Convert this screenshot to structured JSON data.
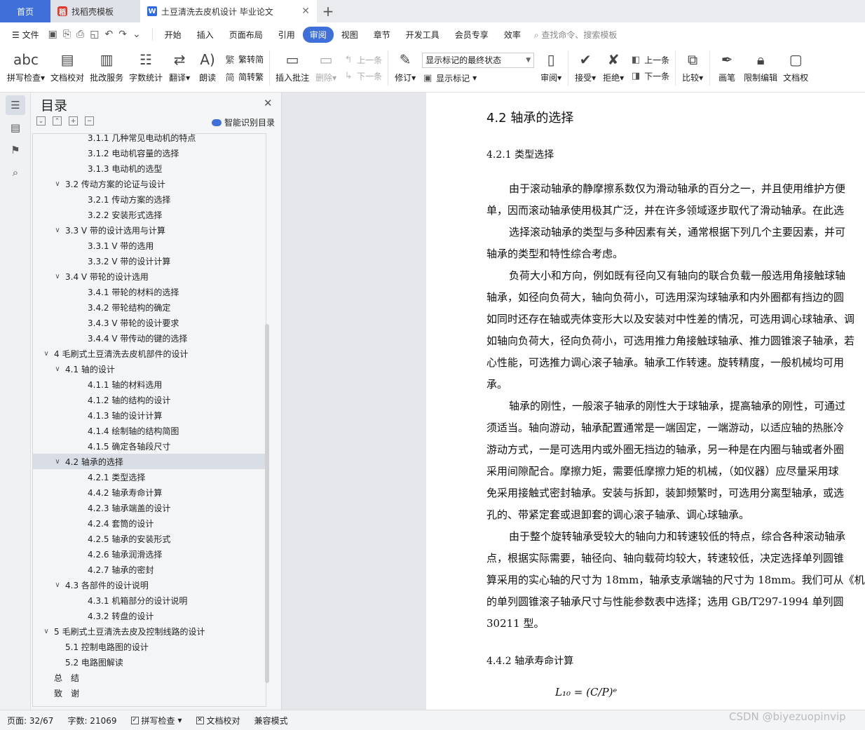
{
  "tabs": [
    {
      "label": "首页"
    },
    {
      "label": "找稻壳模板"
    },
    {
      "label": "土豆清洗去皮机设计 毕业论文"
    }
  ],
  "menu": {
    "file": "文件",
    "items": [
      "开始",
      "插入",
      "页面布局",
      "引用",
      "审阅",
      "视图",
      "章节",
      "开发工具",
      "会员专享",
      "效率"
    ],
    "active": "审阅",
    "search_placeholder": "查找命令、搜索模板"
  },
  "ribbon": {
    "spell_check": "拼写检查",
    "doc_proof": "文档校对",
    "annotate_service": "批改服务",
    "word_count": "字数统计",
    "translate": "翻译",
    "read_aloud": "朗读",
    "to_traditional": "繁转简",
    "to_simplified": "简转繁",
    "insert_comment": "插入批注",
    "delete": "删除",
    "prev_comment": "上一条",
    "next_comment": "下一条",
    "track": "修订",
    "markup_view": "显示标记的最终状态",
    "show_markup": "显示标记",
    "review": "审阅",
    "accept": "接受",
    "reject": "拒绝",
    "prev_change": "上一条",
    "next_change": "下一条",
    "compare": "比较",
    "ink": "画笔",
    "restrict": "限制编辑",
    "doc_perm": "文档权"
  },
  "toc": {
    "title": "目录",
    "smart_label": "智能识别目录",
    "items": [
      {
        "text": "3.1.1 几种常见电动机的特点",
        "level": 3
      },
      {
        "text": "3.1.2 电动机容量的选择",
        "level": 3
      },
      {
        "text": "3.1.3 电动机的选型",
        "level": 3
      },
      {
        "text": "3.2 传动方案的论证与设计",
        "level": 2
      },
      {
        "text": "3.2.1 传动方案的选择",
        "level": 3
      },
      {
        "text": "3.2.2 安装形式选择",
        "level": 3
      },
      {
        "text": "3.3 V 带的设计选用与计算",
        "level": 2
      },
      {
        "text": "3.3.1 V 带的选用",
        "level": 3
      },
      {
        "text": "3.3.2 V 带的设计计算",
        "level": 3
      },
      {
        "text": "3.4 V 带轮的设计选用",
        "level": 2
      },
      {
        "text": "3.4.1 带轮的材料的选择",
        "level": 3
      },
      {
        "text": "3.4.2 带轮结构的确定",
        "level": 3
      },
      {
        "text": "3.4.3 V 带轮的设计要求",
        "level": 3
      },
      {
        "text": "3.4.4 V 带传动的键的选择",
        "level": 3
      },
      {
        "text": "4 毛刷式土豆清洗去皮机部件的设计",
        "level": 1
      },
      {
        "text": "4.1 轴的设计",
        "level": 2
      },
      {
        "text": "4.1.1 轴的材料选用",
        "level": 3
      },
      {
        "text": "4.1.2 轴的结构的设计",
        "level": 3
      },
      {
        "text": "4.1.3 轴的设计计算",
        "level": 3
      },
      {
        "text": "4.1.4 绘制轴的结构简图",
        "level": 3
      },
      {
        "text": "4.1.5 确定各轴段尺寸",
        "level": 3
      },
      {
        "text": "4.2 轴承的选择",
        "level": 2
      },
      {
        "text": "4.2.1 类型选择",
        "level": 3
      },
      {
        "text": "4.4.2 轴承寿命计算",
        "level": 3
      },
      {
        "text": "4.2.3 轴承端盖的设计",
        "level": 3
      },
      {
        "text": "4.2.4 套筒的设计",
        "level": 3
      },
      {
        "text": "4.2.5 轴承的安装形式",
        "level": 3
      },
      {
        "text": "4.2.6 轴承润滑选择",
        "level": 3
      },
      {
        "text": "4.2.7 轴承的密封",
        "level": 3
      },
      {
        "text": "4.3 各部件的设计说明",
        "level": 2
      },
      {
        "text": "4.3.1 机箱部分的设计说明",
        "level": 3
      },
      {
        "text": "4.3.2 转盘的设计",
        "level": 3
      },
      {
        "text": "5 毛刷式土豆清洗去皮及控制线路的设计",
        "level": 1
      },
      {
        "text": "5.1 控制电路图的设计",
        "level": 2
      },
      {
        "text": "5.2 电路图解读",
        "level": 2
      },
      {
        "text": "总　结",
        "level": 1
      },
      {
        "text": "致　谢",
        "level": 1
      }
    ],
    "selected_index": 21
  },
  "document": {
    "heading": "4.2 轴承的选择",
    "sub1": "4.2.1 类型选择",
    "lines": [
      {
        "text": "由于滚动轴承的静摩擦系数仅为滑动轴承的百分之一，并且使用维护方便",
        "indent": true
      },
      {
        "text": "单，因而滚动轴承使用极其广泛，并在许多领域逐步取代了滑动轴承。在此选",
        "indent": false
      },
      {
        "text": "选择滚动轴承的类型与多种因素有关，通常根据下列几个主要因素，并可",
        "indent": true
      },
      {
        "text": "轴承的类型和特性综合考虑。",
        "indent": false
      },
      {
        "text": "负荷大小和方向，例如既有径向又有轴向的联合负载一般选用角接触球轴",
        "indent": true
      },
      {
        "text": "轴承，如径向负荷大，轴向负荷小，可选用深沟球轴承和内外圈都有挡边的圆",
        "indent": false
      },
      {
        "text": "如同时还存在轴或壳体变形大以及安装对中性差的情况，可选用调心球轴承、调",
        "indent": false
      },
      {
        "text": "如轴向负荷大，径向负荷小，可选用推力角接触球轴承、推力圆锥滚子轴承，若",
        "indent": false
      },
      {
        "text": "心性能，可选推力调心滚子轴承。轴承工作转速。旋转精度，一般机械均可用",
        "indent": false
      },
      {
        "text": "承。",
        "indent": false
      },
      {
        "text": "轴承的刚性，一般滚子轴承的刚性大于球轴承，提高轴承的刚性，可通过",
        "indent": true
      },
      {
        "text": "须适当。轴向游动，轴承配置通常是一端固定，一端游动，以适应轴的热胀冷",
        "indent": false
      },
      {
        "text": "游动方式，一是可选用内或外圈无挡边的轴承，另一种是在内圈与轴或者外圈",
        "indent": false
      },
      {
        "text": "采用间隙配合。摩擦力矩，需要低摩擦力矩的机械，（如仪器）应尽量采用球",
        "indent": false
      },
      {
        "text": "免采用接触式密封轴承。安装与拆卸，装卸频繁时，可选用分离型轴承，或选",
        "indent": false
      },
      {
        "text": "孔的、带紧定套或退卸套的调心滚子轴承、调心球轴承。",
        "indent": false
      },
      {
        "text": "由于整个旋转轴承受较大的轴向力和转速较低的特点，综合各种滚动轴承",
        "indent": true
      },
      {
        "text": "点，根据实际需要，轴径向、轴向载荷均较大，转速较低，决定选择单列圆锥",
        "indent": false
      },
      {
        "text": "算采用的实心轴的尺寸为 18mm，轴承支承端轴的尺寸为 18mm。我们可从《机",
        "indent": false
      },
      {
        "text": "的单列圆锥滚子轴承尺寸与性能参数表中选择；选用 GB/T297-1994 单列圆",
        "indent": false
      },
      {
        "text": "30211 型。",
        "indent": false
      }
    ],
    "sub2": "4.4.2 轴承寿命计算",
    "formula": "L₁₀ = (C/P)ᵉ"
  },
  "status": {
    "page": "页面: 32/67",
    "words": "字数: 21069",
    "spell": "拼写检查",
    "proof": "文档校对",
    "compat": "兼容模式"
  },
  "watermark": "CSDN @biyezuopinvip"
}
